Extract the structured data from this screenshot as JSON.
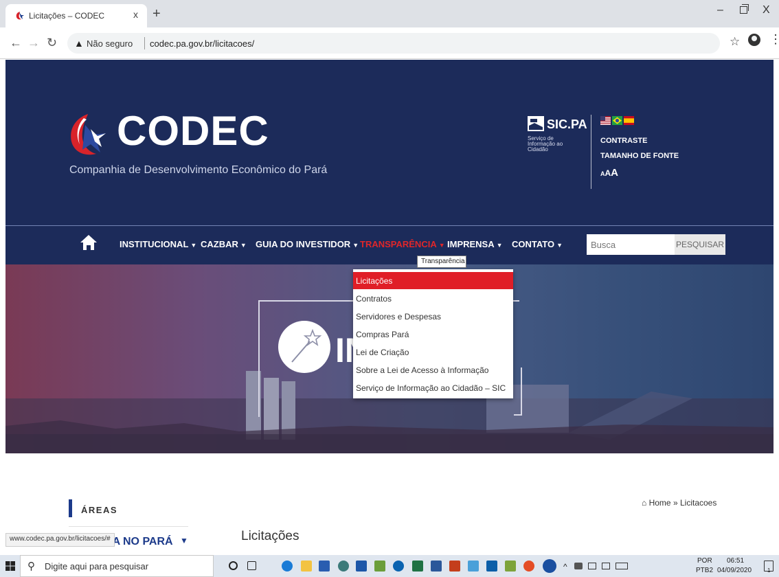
{
  "browser": {
    "tab_title": "Licitações – CODEC",
    "tab_close": "x",
    "new_tab": "+",
    "win_min": "–",
    "win_close": "X",
    "insecure_label": "Não seguro",
    "url": "codec.pa.gov.br/licitacoes/",
    "status_url": "www.codec.pa.gov.br/licitacoes/#"
  },
  "header": {
    "logo_text": "CODEC",
    "logo_subtitle": "Companhia de Desenvolvimento Econômico do Pará",
    "sic_title": "SIC.PA",
    "sic_subtitle": "Serviço de Informação ao Cidadão",
    "contrast": "CONTRASTE",
    "font_size_label": "TAMANHO DE FONTE",
    "font_size_small": "A",
    "font_size_medium": "A",
    "font_size_large": "A"
  },
  "nav": {
    "items": [
      {
        "label": "INSTITUCIONAL"
      },
      {
        "label": "CAZBAR"
      },
      {
        "label": "GUIA DO INVESTIDOR"
      },
      {
        "label": "TRANSPARÊNCIA"
      },
      {
        "label": "IMPRENSA"
      },
      {
        "label": "CONTATO"
      }
    ],
    "search_placeholder": "Busca",
    "search_button": "PESQUISAR"
  },
  "tooltip": "Transparência",
  "dropdown": {
    "items": [
      "Licitações",
      "Contratos",
      "Servidores e Despesas",
      "Compras Pará",
      "Lei de Criação",
      "Sobre a Lei de Acesso à Informação",
      "Serviço de Informação ao Cidadão – SIC"
    ]
  },
  "banner": {
    "text": "IN"
  },
  "content": {
    "areas_title": "ÁREAS",
    "side_item": "TA NO PARÁ",
    "breadcrumb_home": "Home",
    "breadcrumb_sep": "»",
    "breadcrumb_current": "Licitacoes",
    "page_heading": "Licitações"
  },
  "taskbar": {
    "search_placeholder": "Digite aqui para pesquisar",
    "lang": "POR",
    "layout": "PTB2",
    "time": "06:51",
    "date": "04/09/2020",
    "notif_count": "1"
  },
  "colors": {
    "header_bg": "#1c2b5a",
    "accent_red": "#e01e27"
  }
}
